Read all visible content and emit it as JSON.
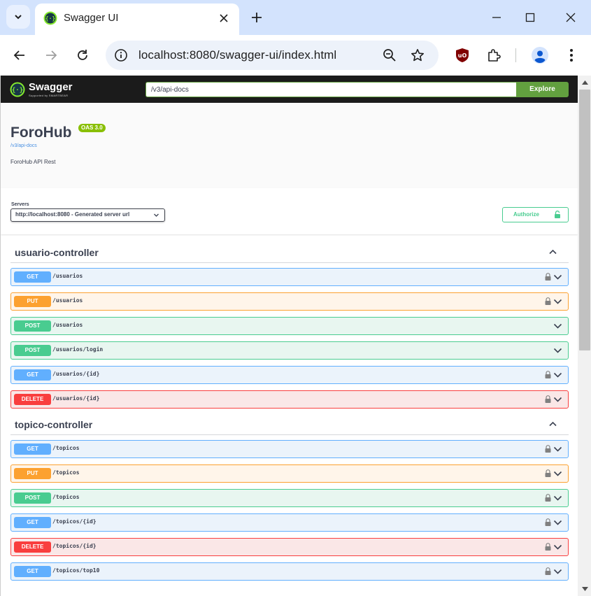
{
  "browser": {
    "tab_title": "Swagger UI",
    "url": "localhost:8080/swagger-ui/index.html"
  },
  "swagger": {
    "logo_name": "Swagger",
    "logo_sub": "Supported by SMARTBEAR",
    "search_value": "/v3/api-docs",
    "explore_label": "Explore",
    "title": "ForoHub",
    "oas_badge": "OAS 3.0",
    "spec_link": "/v3/api-docs",
    "description": "ForoHub API Rest",
    "servers_label": "Servers",
    "server_selected": "http://localhost:8080 - Generated server url",
    "authorize_label": "Authorize"
  },
  "sections": [
    {
      "title": "usuario-controller",
      "ops": [
        {
          "method": "GET",
          "path": "/usuarios",
          "locked": true
        },
        {
          "method": "PUT",
          "path": "/usuarios",
          "locked": true
        },
        {
          "method": "POST",
          "path": "/usuarios",
          "locked": false
        },
        {
          "method": "POST",
          "path": "/usuarios/login",
          "locked": false
        },
        {
          "method": "GET",
          "path": "/usuarios/{id}",
          "locked": true
        },
        {
          "method": "DELETE",
          "path": "/usuarios/{id}",
          "locked": true
        }
      ]
    },
    {
      "title": "topico-controller",
      "ops": [
        {
          "method": "GET",
          "path": "/topicos",
          "locked": true
        },
        {
          "method": "PUT",
          "path": "/topicos",
          "locked": true
        },
        {
          "method": "POST",
          "path": "/topicos",
          "locked": true
        },
        {
          "method": "GET",
          "path": "/topicos/{id}",
          "locked": true
        },
        {
          "method": "DELETE",
          "path": "/topicos/{id}",
          "locked": true
        },
        {
          "method": "GET",
          "path": "/topicos/top10",
          "locked": true
        }
      ]
    }
  ],
  "colors": {
    "get": "#61affe",
    "put": "#fca130",
    "post": "#49cc90",
    "delete": "#f93e3e",
    "swagger_green": "#62a03f",
    "oas_badge": "#89bf04"
  }
}
